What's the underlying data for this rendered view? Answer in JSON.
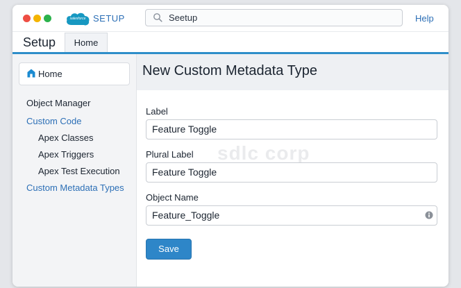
{
  "topbar": {
    "brand_logo_text": "salesforce",
    "app_name": "SETUP",
    "search_value": "Seetup",
    "help_label": "Help"
  },
  "nav": {
    "title": "Setup",
    "tab_home": "Home"
  },
  "sidebar": {
    "home_label": "Home",
    "items": [
      {
        "label": "Object Manager"
      },
      {
        "label": "Custom Code"
      },
      {
        "label": "Apex Classes"
      },
      {
        "label": "Apex Triggers"
      },
      {
        "label": "Apex Test Execution"
      },
      {
        "label": "Custom Metadata Types"
      }
    ]
  },
  "main": {
    "title": "New Custom Metadata Type",
    "watermark": "sdlc corp",
    "fields": [
      {
        "label": "Label",
        "value": "Feature Toggle"
      },
      {
        "label": "Plural Label",
        "value": "Feature Toggle"
      },
      {
        "label": "Object Name",
        "value": "Feature_Toggle"
      }
    ],
    "save_label": "Save"
  },
  "colors": {
    "accent": "#2e8ec9",
    "link": "#2c6fb6",
    "save_button": "#2e86c8"
  }
}
